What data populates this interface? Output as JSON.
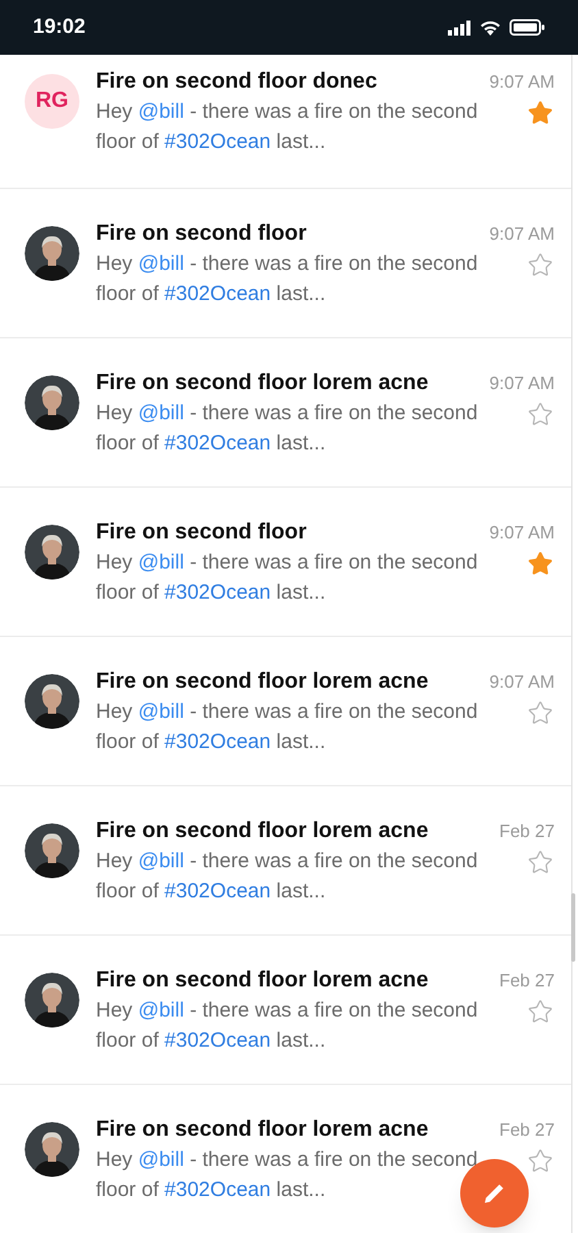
{
  "status_bar": {
    "time": "19:02"
  },
  "messages": [
    {
      "avatar": {
        "kind": "initials",
        "initials": "RG"
      },
      "title": "Fire on second floor donec",
      "time": "9:07 AM",
      "starred": true,
      "preview": [
        {
          "kind": "text",
          "text": "Hey "
        },
        {
          "kind": "mention",
          "text": "@bill"
        },
        {
          "kind": "text",
          "text": " - there was a fire on the second floor of "
        },
        {
          "kind": "tag",
          "text": "#302Ocean"
        },
        {
          "kind": "text",
          "text": " last..."
        }
      ]
    },
    {
      "title": "Fire on second floor",
      "time": "9:07 AM",
      "starred": false,
      "preview": [
        {
          "kind": "text",
          "text": "Hey "
        },
        {
          "kind": "mention",
          "text": "@bill"
        },
        {
          "kind": "text",
          "text": " - there was a fire on the second floor of "
        },
        {
          "kind": "tag",
          "text": "#302Ocean"
        },
        {
          "kind": "text",
          "text": " last..."
        }
      ]
    },
    {
      "title": "Fire on second floor lorem acne",
      "time": "9:07 AM",
      "starred": false,
      "preview": [
        {
          "kind": "text",
          "text": "Hey "
        },
        {
          "kind": "mention",
          "text": "@bill"
        },
        {
          "kind": "text",
          "text": " - there was a fire on the second floor of "
        },
        {
          "kind": "tag",
          "text": "#302Ocean"
        },
        {
          "kind": "text",
          "text": " last..."
        }
      ]
    },
    {
      "title": "Fire on second floor",
      "time": "9:07 AM",
      "starred": true,
      "preview": [
        {
          "kind": "text",
          "text": "Hey "
        },
        {
          "kind": "mention",
          "text": "@bill"
        },
        {
          "kind": "text",
          "text": " - there was a fire on the second floor of "
        },
        {
          "kind": "tag",
          "text": "#302Ocean"
        },
        {
          "kind": "text",
          "text": " last..."
        }
      ]
    },
    {
      "title": "Fire on second floor lorem acne",
      "time": "9:07 AM",
      "starred": false,
      "preview": [
        {
          "kind": "text",
          "text": "Hey "
        },
        {
          "kind": "mention",
          "text": "@bill"
        },
        {
          "kind": "text",
          "text": " - there was a fire on the second floor of "
        },
        {
          "kind": "tag",
          "text": "#302Ocean"
        },
        {
          "kind": "text",
          "text": " last..."
        }
      ]
    },
    {
      "title": "Fire on second floor lorem acne",
      "time": "Feb 27",
      "starred": false,
      "preview": [
        {
          "kind": "text",
          "text": "Hey "
        },
        {
          "kind": "mention",
          "text": "@bill"
        },
        {
          "kind": "text",
          "text": " - there was a fire on the second floor of "
        },
        {
          "kind": "tag",
          "text": "#302Ocean"
        },
        {
          "kind": "text",
          "text": " last..."
        }
      ]
    },
    {
      "title": "Fire on second floor lorem acne",
      "time": "Feb 27",
      "starred": false,
      "preview": [
        {
          "kind": "text",
          "text": "Hey "
        },
        {
          "kind": "mention",
          "text": "@bill"
        },
        {
          "kind": "text",
          "text": " - there was a fire on the second floor of "
        },
        {
          "kind": "tag",
          "text": "#302Ocean"
        },
        {
          "kind": "text",
          "text": " last..."
        }
      ]
    },
    {
      "title": "Fire on second floor lorem acne",
      "time": "Feb 27",
      "starred": false,
      "preview": [
        {
          "kind": "text",
          "text": "Hey "
        },
        {
          "kind": "mention",
          "text": "@bill"
        },
        {
          "kind": "text",
          "text": " - there was a fire on the second floor of "
        },
        {
          "kind": "tag",
          "text": "#302Ocean"
        },
        {
          "kind": "text",
          "text": " last..."
        }
      ]
    }
  ]
}
